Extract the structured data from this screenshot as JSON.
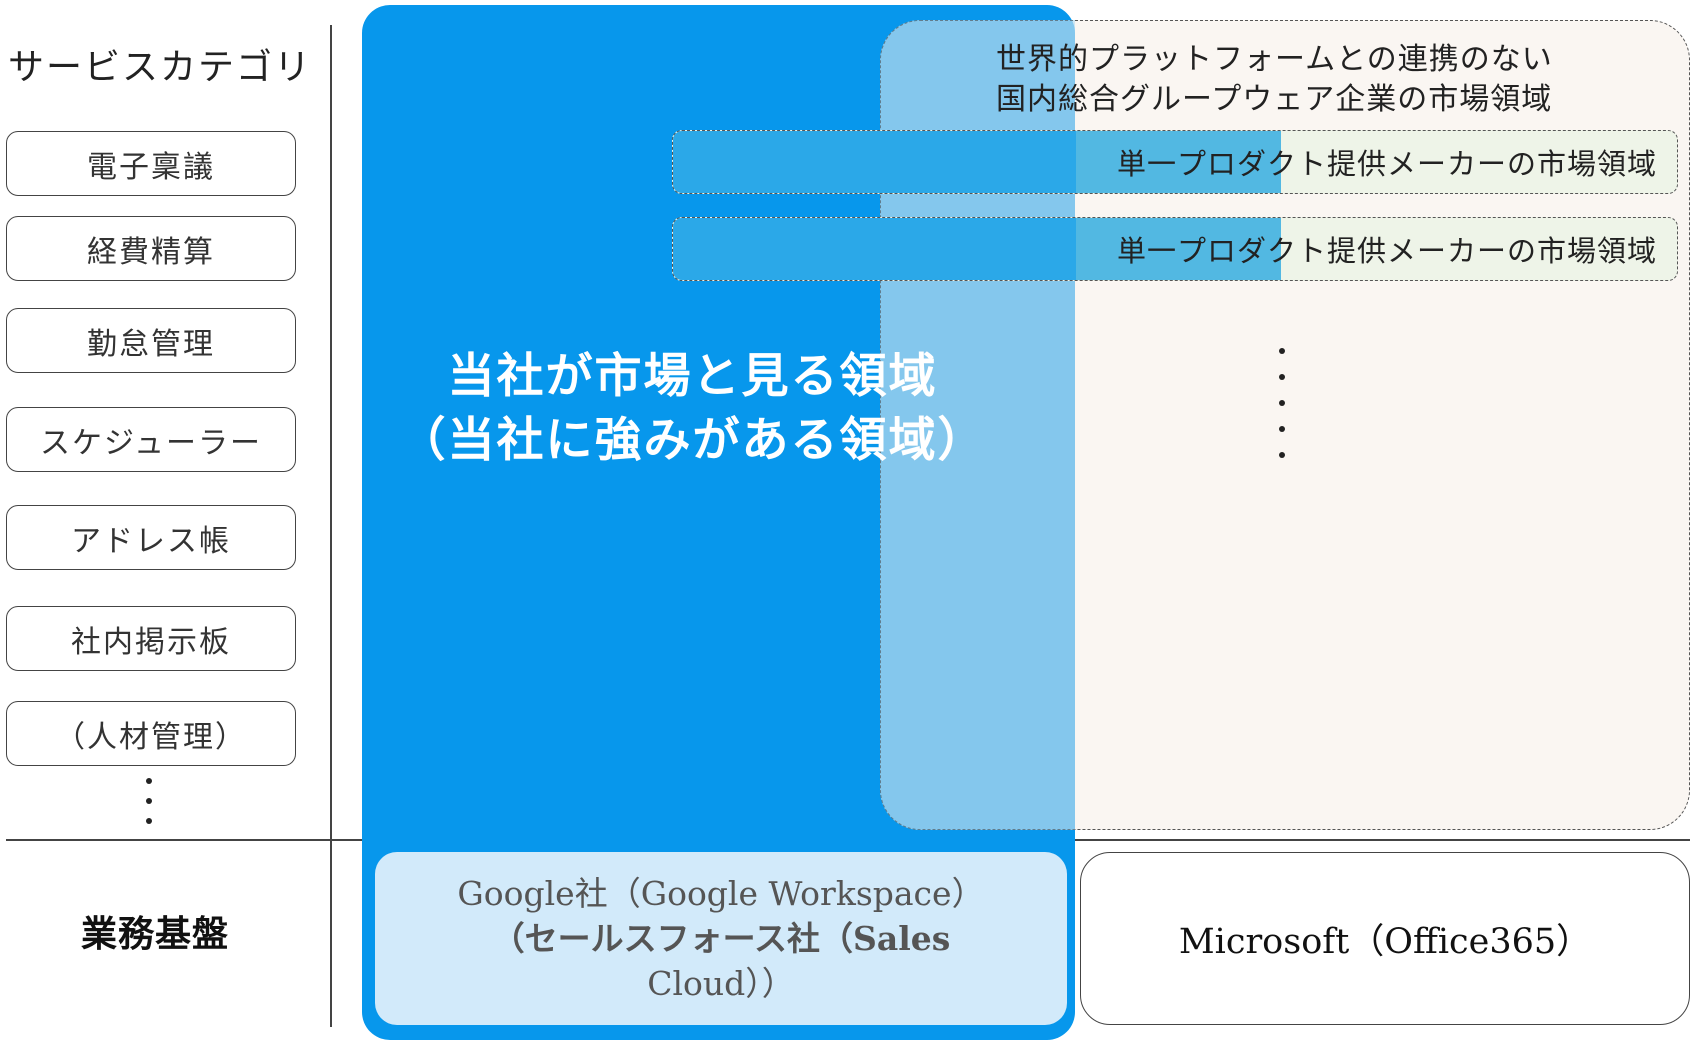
{
  "categories": {
    "title": "サービスカテゴリ",
    "items": [
      "電子稟議",
      "経費精算",
      "勤怠管理",
      "スケジューラー",
      "アドレス帳",
      "社内掲示板",
      "（人材管理）"
    ]
  },
  "our_market": {
    "line1": "当社が市場と見る領域",
    "line2": "（当社に強みがある領域）"
  },
  "domestic_market": {
    "line1": "世界的プラットフォームとの連携のない",
    "line2": "国内総合グループウェア企業の市場領域"
  },
  "single_product": [
    "単一プロダクト提供メーカーの市場領域",
    "単一プロダクト提供メーカーの市場領域"
  ],
  "platform": {
    "label": "業務基盤",
    "google_line1": "Google社（Google Workspace）",
    "google_line2": "（セールスフォース社（Sales",
    "google_line3": "Cloud））",
    "microsoft": "Microsoft（Office365）"
  },
  "colors": {
    "our_region": "#0797ec",
    "domestic_region": "#f6efe7",
    "single_product_region": "#eef4e8",
    "google_box": "#d2eafa"
  }
}
